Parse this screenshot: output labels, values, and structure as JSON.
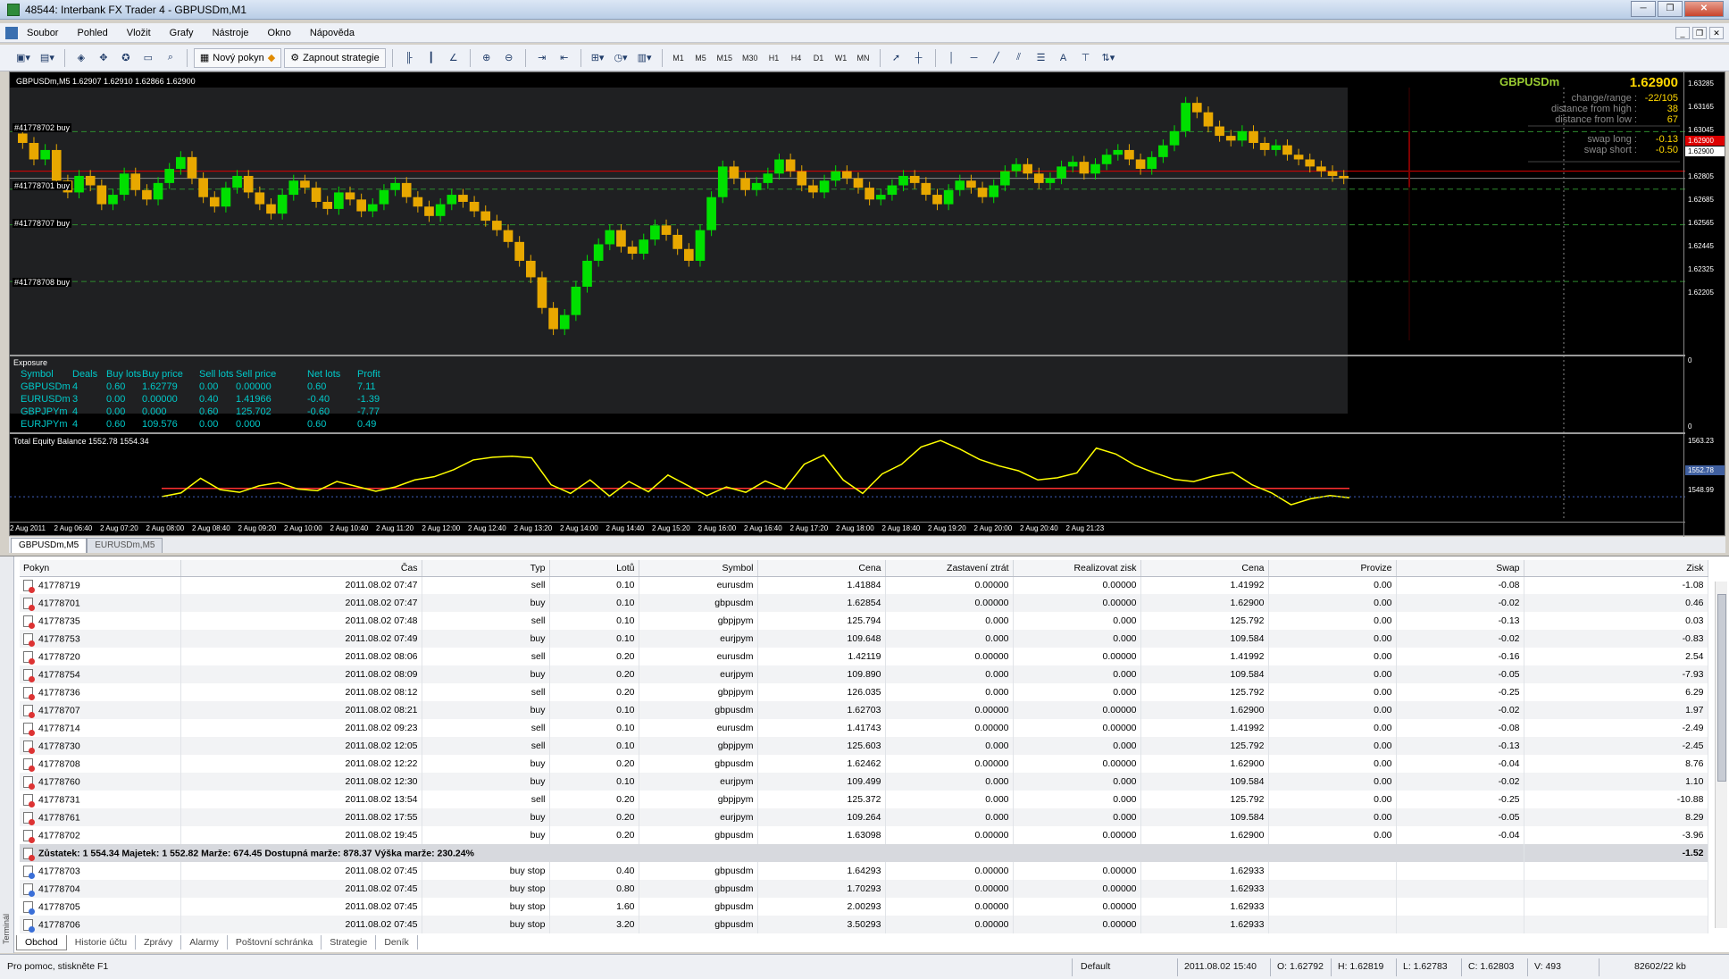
{
  "window": {
    "title": "48544: Interbank FX Trader 4 - GBPUSDm,M1"
  },
  "menu": [
    "Soubor",
    "Pohled",
    "Vložit",
    "Grafy",
    "Nástroje",
    "Okno",
    "Nápověda"
  ],
  "toolbar": {
    "new_order": "Nový pokyn",
    "strategies": "Zapnout strategie",
    "timeframes": [
      "M1",
      "M5",
      "M15",
      "M30",
      "H1",
      "H4",
      "D1",
      "W1",
      "MN"
    ]
  },
  "chart": {
    "header": "GBPUSDm,M5  1.62907 1.62910 1.62866 1.62900",
    "symbol": "GBPUSDm",
    "price": "1.62900",
    "info": [
      {
        "label": "change/range :",
        "value": "-22/105"
      },
      {
        "label": "distance from high :",
        "value": "38"
      },
      {
        "label": "distance from low :",
        "value": "67"
      },
      {
        "label": "swap long :",
        "value": "-0.13"
      },
      {
        "label": "swap short :",
        "value": "-0.50"
      }
    ],
    "price_ticks": [
      "1.63285",
      "1.63165",
      "1.63045",
      "1.62925",
      "1.62805",
      "1.62685",
      "1.62565",
      "1.62445",
      "1.62325",
      "1.62205"
    ],
    "current_price_label": "1.62900",
    "red_label": "1.62900",
    "order_lines": [
      "#41778702 buy",
      "#41778701 buy",
      "#41778707 buy",
      "#41778708 buy"
    ],
    "exposure_title": "Exposure",
    "exposure_headers": [
      "Symbol",
      "Deals",
      "Buy lots",
      "Buy price",
      "Sell lots",
      "Sell price",
      "Net lots",
      "Profit"
    ],
    "exposure_rows": [
      [
        "GBPUSDm",
        "4",
        "0.60",
        "1.62779",
        "0.00",
        "0.00000",
        "0.60",
        "7.11"
      ],
      [
        "EURUSDm",
        "3",
        "0.00",
        "0.00000",
        "0.40",
        "1.41966",
        "-0.40",
        "-1.39"
      ],
      [
        "GBPJPYm",
        "4",
        "0.00",
        "0.000",
        "0.60",
        "125.702",
        "-0.60",
        "-7.77"
      ],
      [
        "EURJPYm",
        "4",
        "0.60",
        "109.576",
        "0.00",
        "0.000",
        "0.60",
        "0.49"
      ]
    ],
    "exposure_scale": [
      "0",
      "0"
    ],
    "equity_title": "Total Equity Balance 1552.78 1554.34",
    "equity_scale": [
      "1563.23",
      "1552.78",
      "1548.99"
    ],
    "time_labels": [
      "2 Aug 2011",
      "2 Aug 06:40",
      "2 Aug 07:20",
      "2 Aug 08:00",
      "2 Aug 08:40",
      "2 Aug 09:20",
      "2 Aug 10:00",
      "2 Aug 10:40",
      "2 Aug 11:20",
      "2 Aug 12:00",
      "2 Aug 12:40",
      "2 Aug 13:20",
      "2 Aug 14:00",
      "2 Aug 14:40",
      "2 Aug 15:20",
      "2 Aug 16:00",
      "2 Aug 16:40",
      "2 Aug 17:20",
      "2 Aug 18:00",
      "2 Aug 18:40",
      "2 Aug 19:20",
      "2 Aug 20:00",
      "2 Aug 20:40",
      "2 Aug 21:23"
    ],
    "tabs": [
      "GBPUSDm,M5",
      "EURUSDm,M5"
    ]
  },
  "chart_data": {
    "type": "candlestick",
    "closes": [
      1.6305,
      1.6298,
      1.6302,
      1.6289,
      1.6284,
      1.6291,
      1.6287,
      1.6279,
      1.6283,
      1.6292,
      1.6285,
      1.6281,
      1.6288,
      1.6294,
      1.6299,
      1.629,
      1.6282,
      1.6278,
      1.6286,
      1.6291,
      1.6284,
      1.6279,
      1.6275,
      1.6283,
      1.6289,
      1.6286,
      1.628,
      1.6277,
      1.6284,
      1.6281,
      1.6276,
      1.6279,
      1.6285,
      1.6288,
      1.6282,
      1.6278,
      1.6274,
      1.6279,
      1.6283,
      1.628,
      1.6276,
      1.6272,
      1.6268,
      1.6263,
      1.6255,
      1.6248,
      1.6235,
      1.6226,
      1.6232,
      1.6244,
      1.6255,
      1.6262,
      1.6268,
      1.6261,
      1.6258,
      1.6264,
      1.627,
      1.6266,
      1.626,
      1.6255,
      1.6268,
      1.6282,
      1.6295,
      1.629,
      1.6285,
      1.6288,
      1.6292,
      1.6298,
      1.6293,
      1.6287,
      1.6284,
      1.6289,
      1.6293,
      1.629,
      1.6286,
      1.6281,
      1.6283,
      1.6287,
      1.6291,
      1.6288,
      1.6283,
      1.6279,
      1.6285,
      1.6289,
      1.6286,
      1.6282,
      1.6287,
      1.6293,
      1.6296,
      1.6292,
      1.6288,
      1.629,
      1.6295,
      1.6297,
      1.6292,
      1.6296,
      1.63,
      1.6302,
      1.6298,
      1.6294,
      1.6299,
      1.6304,
      1.631,
      1.6322,
      1.6318,
      1.6312,
      1.6308,
      1.6306,
      1.631,
      1.6305,
      1.6302,
      1.6304,
      1.63,
      1.6298,
      1.6295,
      1.6293,
      1.6291,
      1.629
    ],
    "equity": [
      1552.8,
      1553.5,
      1556.2,
      1554.1,
      1553.6,
      1554.8,
      1555.4,
      1554.2,
      1553.9,
      1555.6,
      1554.7,
      1553.8,
      1554.6,
      1555.9,
      1556.5,
      1557.8,
      1559.6,
      1560.1,
      1560.3,
      1560.0,
      1555.0,
      1553.4,
      1555.9,
      1552.9,
      1555.6,
      1553.7,
      1556.8,
      1554.9,
      1553.0,
      1554.6,
      1553.6,
      1555.7,
      1554.2,
      1558.8,
      1560.5,
      1555.9,
      1553.4,
      1557.0,
      1558.8,
      1562.0,
      1563.2,
      1561.6,
      1559.7,
      1558.5,
      1557.6,
      1555.9,
      1556.3,
      1557.2,
      1561.8,
      1560.7,
      1558.6,
      1557.2,
      1556.0,
      1555.6,
      1556.6,
      1557.3,
      1555.0,
      1553.5,
      1551.3,
      1552.4,
      1553.0,
      1552.6
    ],
    "balance": 1554.34,
    "current_equity": 1552.78,
    "ylim_price": [
      1.62205,
      1.63285
    ]
  },
  "terminal": {
    "side_label": "Terminál",
    "headers": [
      "Pokyn",
      "Čas",
      "Typ",
      "Lotů",
      "Symbol",
      "Cena",
      "Zastavení ztrát",
      "Realizovat zisk",
      "Cena",
      "Provize",
      "Swap",
      "Zisk"
    ],
    "rows": [
      [
        "41778719",
        "2011.08.02 07:47",
        "sell",
        "0.10",
        "eurusdm",
        "1.41884",
        "0.00000",
        "0.00000",
        "1.41992",
        "0.00",
        "-0.08",
        "-1.08"
      ],
      [
        "41778701",
        "2011.08.02 07:47",
        "buy",
        "0.10",
        "gbpusdm",
        "1.62854",
        "0.00000",
        "0.00000",
        "1.62900",
        "0.00",
        "-0.02",
        "0.46"
      ],
      [
        "41778735",
        "2011.08.02 07:48",
        "sell",
        "0.10",
        "gbpjpym",
        "125.794",
        "0.000",
        "0.000",
        "125.792",
        "0.00",
        "-0.13",
        "0.03"
      ],
      [
        "41778753",
        "2011.08.02 07:49",
        "buy",
        "0.10",
        "eurjpym",
        "109.648",
        "0.000",
        "0.000",
        "109.584",
        "0.00",
        "-0.02",
        "-0.83"
      ],
      [
        "41778720",
        "2011.08.02 08:06",
        "sell",
        "0.20",
        "eurusdm",
        "1.42119",
        "0.00000",
        "0.00000",
        "1.41992",
        "0.00",
        "-0.16",
        "2.54"
      ],
      [
        "41778754",
        "2011.08.02 08:09",
        "buy",
        "0.20",
        "eurjpym",
        "109.890",
        "0.000",
        "0.000",
        "109.584",
        "0.00",
        "-0.05",
        "-7.93"
      ],
      [
        "41778736",
        "2011.08.02 08:12",
        "sell",
        "0.20",
        "gbpjpym",
        "126.035",
        "0.000",
        "0.000",
        "125.792",
        "0.00",
        "-0.25",
        "6.29"
      ],
      [
        "41778707",
        "2011.08.02 08:21",
        "buy",
        "0.10",
        "gbpusdm",
        "1.62703",
        "0.00000",
        "0.00000",
        "1.62900",
        "0.00",
        "-0.02",
        "1.97"
      ],
      [
        "41778714",
        "2011.08.02 09:23",
        "sell",
        "0.10",
        "eurusdm",
        "1.41743",
        "0.00000",
        "0.00000",
        "1.41992",
        "0.00",
        "-0.08",
        "-2.49"
      ],
      [
        "41778730",
        "2011.08.02 12:05",
        "sell",
        "0.10",
        "gbpjpym",
        "125.603",
        "0.000",
        "0.000",
        "125.792",
        "0.00",
        "-0.13",
        "-2.45"
      ],
      [
        "41778708",
        "2011.08.02 12:22",
        "buy",
        "0.20",
        "gbpusdm",
        "1.62462",
        "0.00000",
        "0.00000",
        "1.62900",
        "0.00",
        "-0.04",
        "8.76"
      ],
      [
        "41778760",
        "2011.08.02 12:30",
        "buy",
        "0.10",
        "eurjpym",
        "109.499",
        "0.000",
        "0.000",
        "109.584",
        "0.00",
        "-0.02",
        "1.10"
      ],
      [
        "41778731",
        "2011.08.02 13:54",
        "sell",
        "0.20",
        "gbpjpym",
        "125.372",
        "0.000",
        "0.000",
        "125.792",
        "0.00",
        "-0.25",
        "-10.88"
      ],
      [
        "41778761",
        "2011.08.02 17:55",
        "buy",
        "0.20",
        "eurjpym",
        "109.264",
        "0.000",
        "0.000",
        "109.584",
        "0.00",
        "-0.05",
        "8.29"
      ],
      [
        "41778702",
        "2011.08.02 19:45",
        "buy",
        "0.20",
        "gbpusdm",
        "1.63098",
        "0.00000",
        "0.00000",
        "1.62900",
        "0.00",
        "-0.04",
        "-3.96"
      ]
    ],
    "summary": {
      "text": "Zůstatek: 1 554.34  Majetek: 1 552.82  Marže: 674.45  Dostupná marže: 878.37  Výška marže: 230.24%",
      "total": "-1.52"
    },
    "pending": [
      [
        "41778703",
        "2011.08.02 07:45",
        "buy stop",
        "0.40",
        "gbpusdm",
        "1.64293",
        "0.00000",
        "0.00000",
        "1.62933"
      ],
      [
        "41778704",
        "2011.08.02 07:45",
        "buy stop",
        "0.80",
        "gbpusdm",
        "1.70293",
        "0.00000",
        "0.00000",
        "1.62933"
      ],
      [
        "41778705",
        "2011.08.02 07:45",
        "buy stop",
        "1.60",
        "gbpusdm",
        "2.00293",
        "0.00000",
        "0.00000",
        "1.62933"
      ],
      [
        "41778706",
        "2011.08.02 07:45",
        "buy stop",
        "3.20",
        "gbpusdm",
        "3.50293",
        "0.00000",
        "0.00000",
        "1.62933"
      ]
    ],
    "tabs": [
      "Obchod",
      "Historie účtu",
      "Zprávy",
      "Alarmy",
      "Poštovní schránka",
      "Strategie",
      "Deník"
    ]
  },
  "status": {
    "help": "Pro pomoc, stiskněte F1",
    "profile": "Default",
    "datetime": "2011.08.02 15:40",
    "open": "O: 1.62792",
    "high": "H: 1.62819",
    "low": "L: 1.62783",
    "close": "C: 1.62803",
    "volume": "V: 493",
    "traffic": "82602/22 kb"
  },
  "colors": {
    "bull": "#00e000",
    "bear": "#e8a800",
    "grid_green": "#2e8b2e",
    "red_line": "#e00000",
    "equity": "#ffff00",
    "exposure_text": "#00c8c8"
  }
}
